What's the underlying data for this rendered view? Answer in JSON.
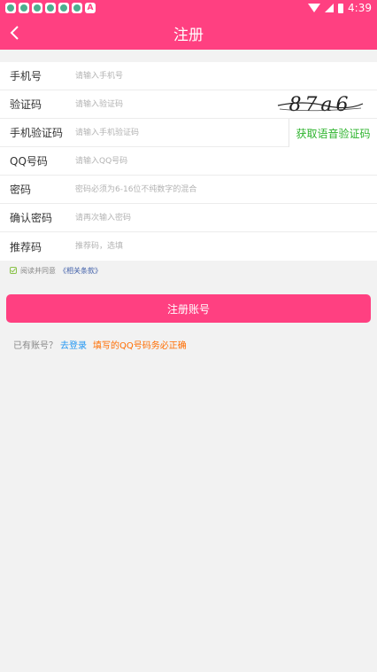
{
  "status_bar": {
    "time": "4:39",
    "notification_icons": [
      "app-icon",
      "app-icon",
      "app-icon",
      "app-icon",
      "app-icon",
      "app-icon",
      "a-icon"
    ],
    "a_letter": "A"
  },
  "header": {
    "title": "注册",
    "background": "#ff4081"
  },
  "form": {
    "phone": {
      "label": "手机号",
      "placeholder": "请输入手机号"
    },
    "captcha": {
      "label": "验证码",
      "placeholder": "请输入验证码",
      "image_text": "87a6"
    },
    "sms_code": {
      "label": "手机验证码",
      "placeholder": "请输入手机验证码",
      "voice_button": "获取语音验证码"
    },
    "qq": {
      "label": "QQ号码",
      "placeholder": "请输入QQ号码"
    },
    "password": {
      "label": "密码",
      "placeholder": "密码必须为6-16位不纯数字的混合"
    },
    "confirm_password": {
      "label": "确认密码",
      "placeholder": "请再次输入密码"
    },
    "referrer": {
      "label": "推荐码",
      "placeholder": "推荐码，选填"
    }
  },
  "agreement": {
    "text": "阅读并同意",
    "link": "《相关条款》",
    "checked": true
  },
  "submit_label": "注册账号",
  "footer": {
    "has_account": "已有账号？",
    "login_link": "去登录",
    "tip": "填写的QQ号码务必正确"
  },
  "colors": {
    "accent": "#ff4081",
    "voice_green": "#2cb32c",
    "link_blue": "#2196f3",
    "tip_orange": "#ff6d00"
  }
}
